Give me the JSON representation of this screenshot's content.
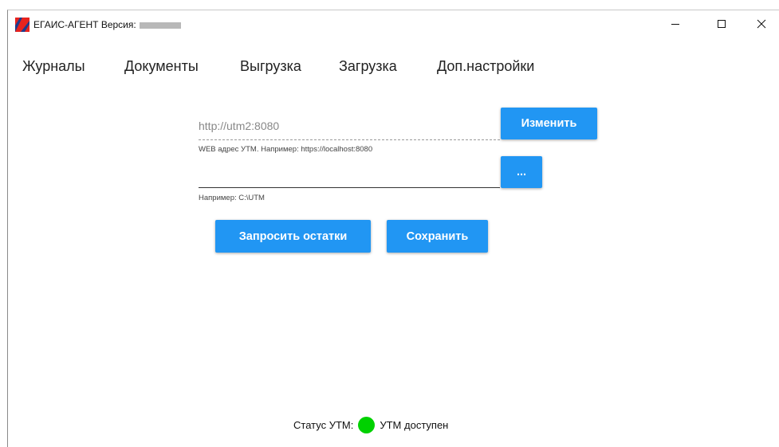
{
  "window": {
    "title": "ЕГАИС-АГЕНТ Версия:",
    "controls": {
      "minimize": "—",
      "maximize": "☐",
      "close": "✕"
    }
  },
  "menu": {
    "items": [
      "Журналы",
      "Документы",
      "Выгрузка",
      "Загрузка",
      "Доп.настройки"
    ]
  },
  "utm": {
    "url_value": "http://utm2:8080",
    "url_hint": "WEB адрес УТМ. Например: https://localhost:8080",
    "change_label": "Изменить",
    "path_value": "",
    "path_hint": "Например: C:\\UTM",
    "browse_label": "..."
  },
  "actions": {
    "request_label": "Запросить остатки",
    "save_label": "Сохранить"
  },
  "status": {
    "label": "Статус УТМ:",
    "text": "УТМ доступен",
    "color": "#00d100"
  },
  "colors": {
    "accent": "#2196f3"
  },
  "icons": {
    "app": "egais-app-icon"
  }
}
